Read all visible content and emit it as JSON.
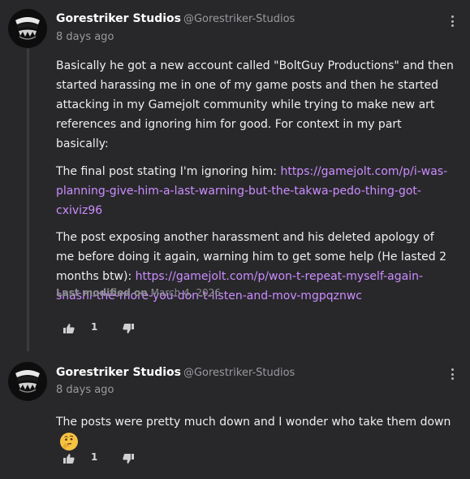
{
  "posts": [
    {
      "author": "Gorestriker Studios",
      "handle": "@Gorestriker-Studios",
      "time": "8 days ago",
      "paragraphs": {
        "p1": "Basically he got a new account called \"BoltGuy Productions\" and then started harassing me in one of my game posts and then he started attacking in my Gamejolt community while trying to make new art references and ignoring him for good. For context in my part basically:",
        "p2_text": "The final post stating I'm ignoring him: ",
        "p2_link": "https://gamejolt.com/p/i-was-planning-give-him-a-last-warning-but-the-takwa-pedo-thing-got-cxiviz96",
        "p3_text": "The post exposing another harassment and his deleted apology of me before doing it again, warning him to get some help (He lasted 2 months btw):  ",
        "p3_link": "https://gamejolt.com/p/won-t-repeat-myself-again-shashi-the-more-you-don-t-listen-and-mov-mgpqznwc"
      },
      "modified_label": "Last modified on",
      "modified_date": "March 4, 2026",
      "likes": "1"
    },
    {
      "author": "Gorestriker Studios",
      "handle": "@Gorestriker-Studios",
      "time": "8 days ago",
      "text": "The posts were pretty much down and I wonder who take them down",
      "emoji": "thinking-face",
      "likes": "1"
    }
  ],
  "colors": {
    "background": "#28282b",
    "link": "#cc8dff",
    "muted": "#9a9a9e"
  }
}
